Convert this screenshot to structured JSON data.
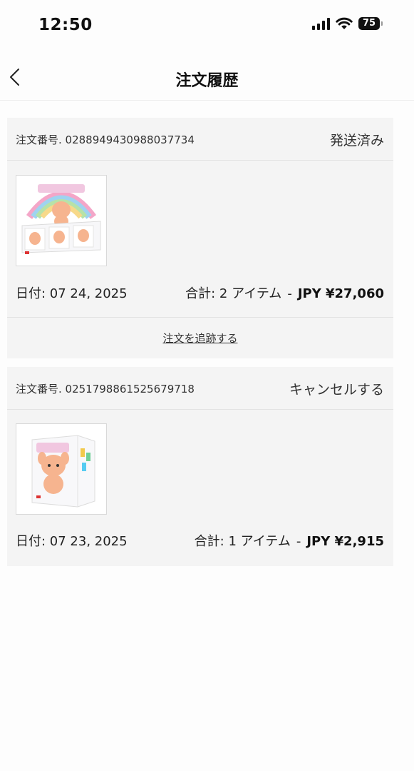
{
  "status_bar": {
    "time": "12:50",
    "battery": "75",
    "icons": [
      "signal-icon",
      "wifi-icon",
      "battery-icon"
    ]
  },
  "nav": {
    "title": "注文履歴",
    "back_icon": "chevron-left-icon"
  },
  "orders": [
    {
      "number_label": "注文番号. 0288949430988037734",
      "status": "発送済み",
      "date": "日付: 07 24, 2025",
      "total_label": "合計: 2 アイテム",
      "separator": "-",
      "price": "JPY ¥27,060",
      "track_link": "注文を追跡する",
      "thumbnail_icon": "product-box-set-thumbnail"
    },
    {
      "number_label": "注文番号. 0251798861525679718",
      "status": "キャンセルする",
      "date": "日付: 07 23, 2025",
      "total_label": "合計: 1 アイテム",
      "separator": "-",
      "price": "JPY ¥2,915",
      "thumbnail_icon": "product-single-box-thumbnail"
    }
  ],
  "colors": {
    "background": "#fdfdfd",
    "card": "#f4f4f4",
    "divider": "#e2e2e2",
    "text": "#222222"
  }
}
